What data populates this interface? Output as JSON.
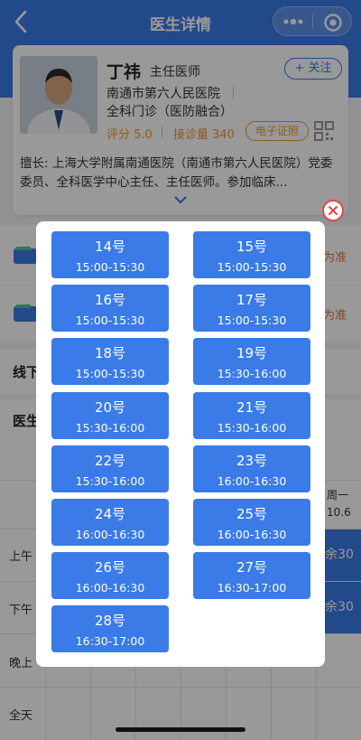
{
  "header": {
    "title": "医生详情",
    "back_icon": "chevron-left-icon",
    "more_icon": "more-dots-icon",
    "target_icon": "target-icon"
  },
  "doctor": {
    "name": "丁祎",
    "title": "主任医师",
    "follow_label": "+ 关注",
    "hospital": "南通市第六人民医院",
    "department": "全科门诊（医防融合）",
    "rating_label": "评分 5.0",
    "consult_label": "接诊量 340",
    "cert_label": "电子证照",
    "expertise": "擅长: 上海大学附属南通医院（南通市第六人民医院）党委委员、全科医学中心主任、主任医师。参加临床..."
  },
  "background": {
    "row_tail": "为准",
    "offline_label": "线下",
    "doctor_label": "医生",
    "weekday": "周一",
    "date": "10.6",
    "periods": [
      "上午",
      "下午",
      "晚上",
      "全天"
    ],
    "remaining": [
      "余30",
      "余30"
    ]
  },
  "modal": {
    "close_icon": "close-circle-icon",
    "slots": [
      {
        "no": "14号",
        "time": "15:00-15:30"
      },
      {
        "no": "15号",
        "time": "15:00-15:30"
      },
      {
        "no": "16号",
        "time": "15:00-15:30"
      },
      {
        "no": "17号",
        "time": "15:00-15:30"
      },
      {
        "no": "18号",
        "time": "15:00-15:30"
      },
      {
        "no": "19号",
        "time": "15:30-16:00"
      },
      {
        "no": "20号",
        "time": "15:30-16:00"
      },
      {
        "no": "21号",
        "time": "15:30-16:00"
      },
      {
        "no": "22号",
        "time": "15:30-16:00"
      },
      {
        "no": "23号",
        "time": "16:00-16:30"
      },
      {
        "no": "24号",
        "time": "16:00-16:30"
      },
      {
        "no": "25号",
        "time": "16:00-16:30"
      },
      {
        "no": "26号",
        "time": "16:00-16:30"
      },
      {
        "no": "27号",
        "time": "16:30-17:00"
      },
      {
        "no": "28号",
        "time": "16:30-17:00"
      }
    ]
  },
  "colors": {
    "accent": "#3a7be7",
    "orange": "#e89a2c",
    "close_red": "#e04848"
  }
}
